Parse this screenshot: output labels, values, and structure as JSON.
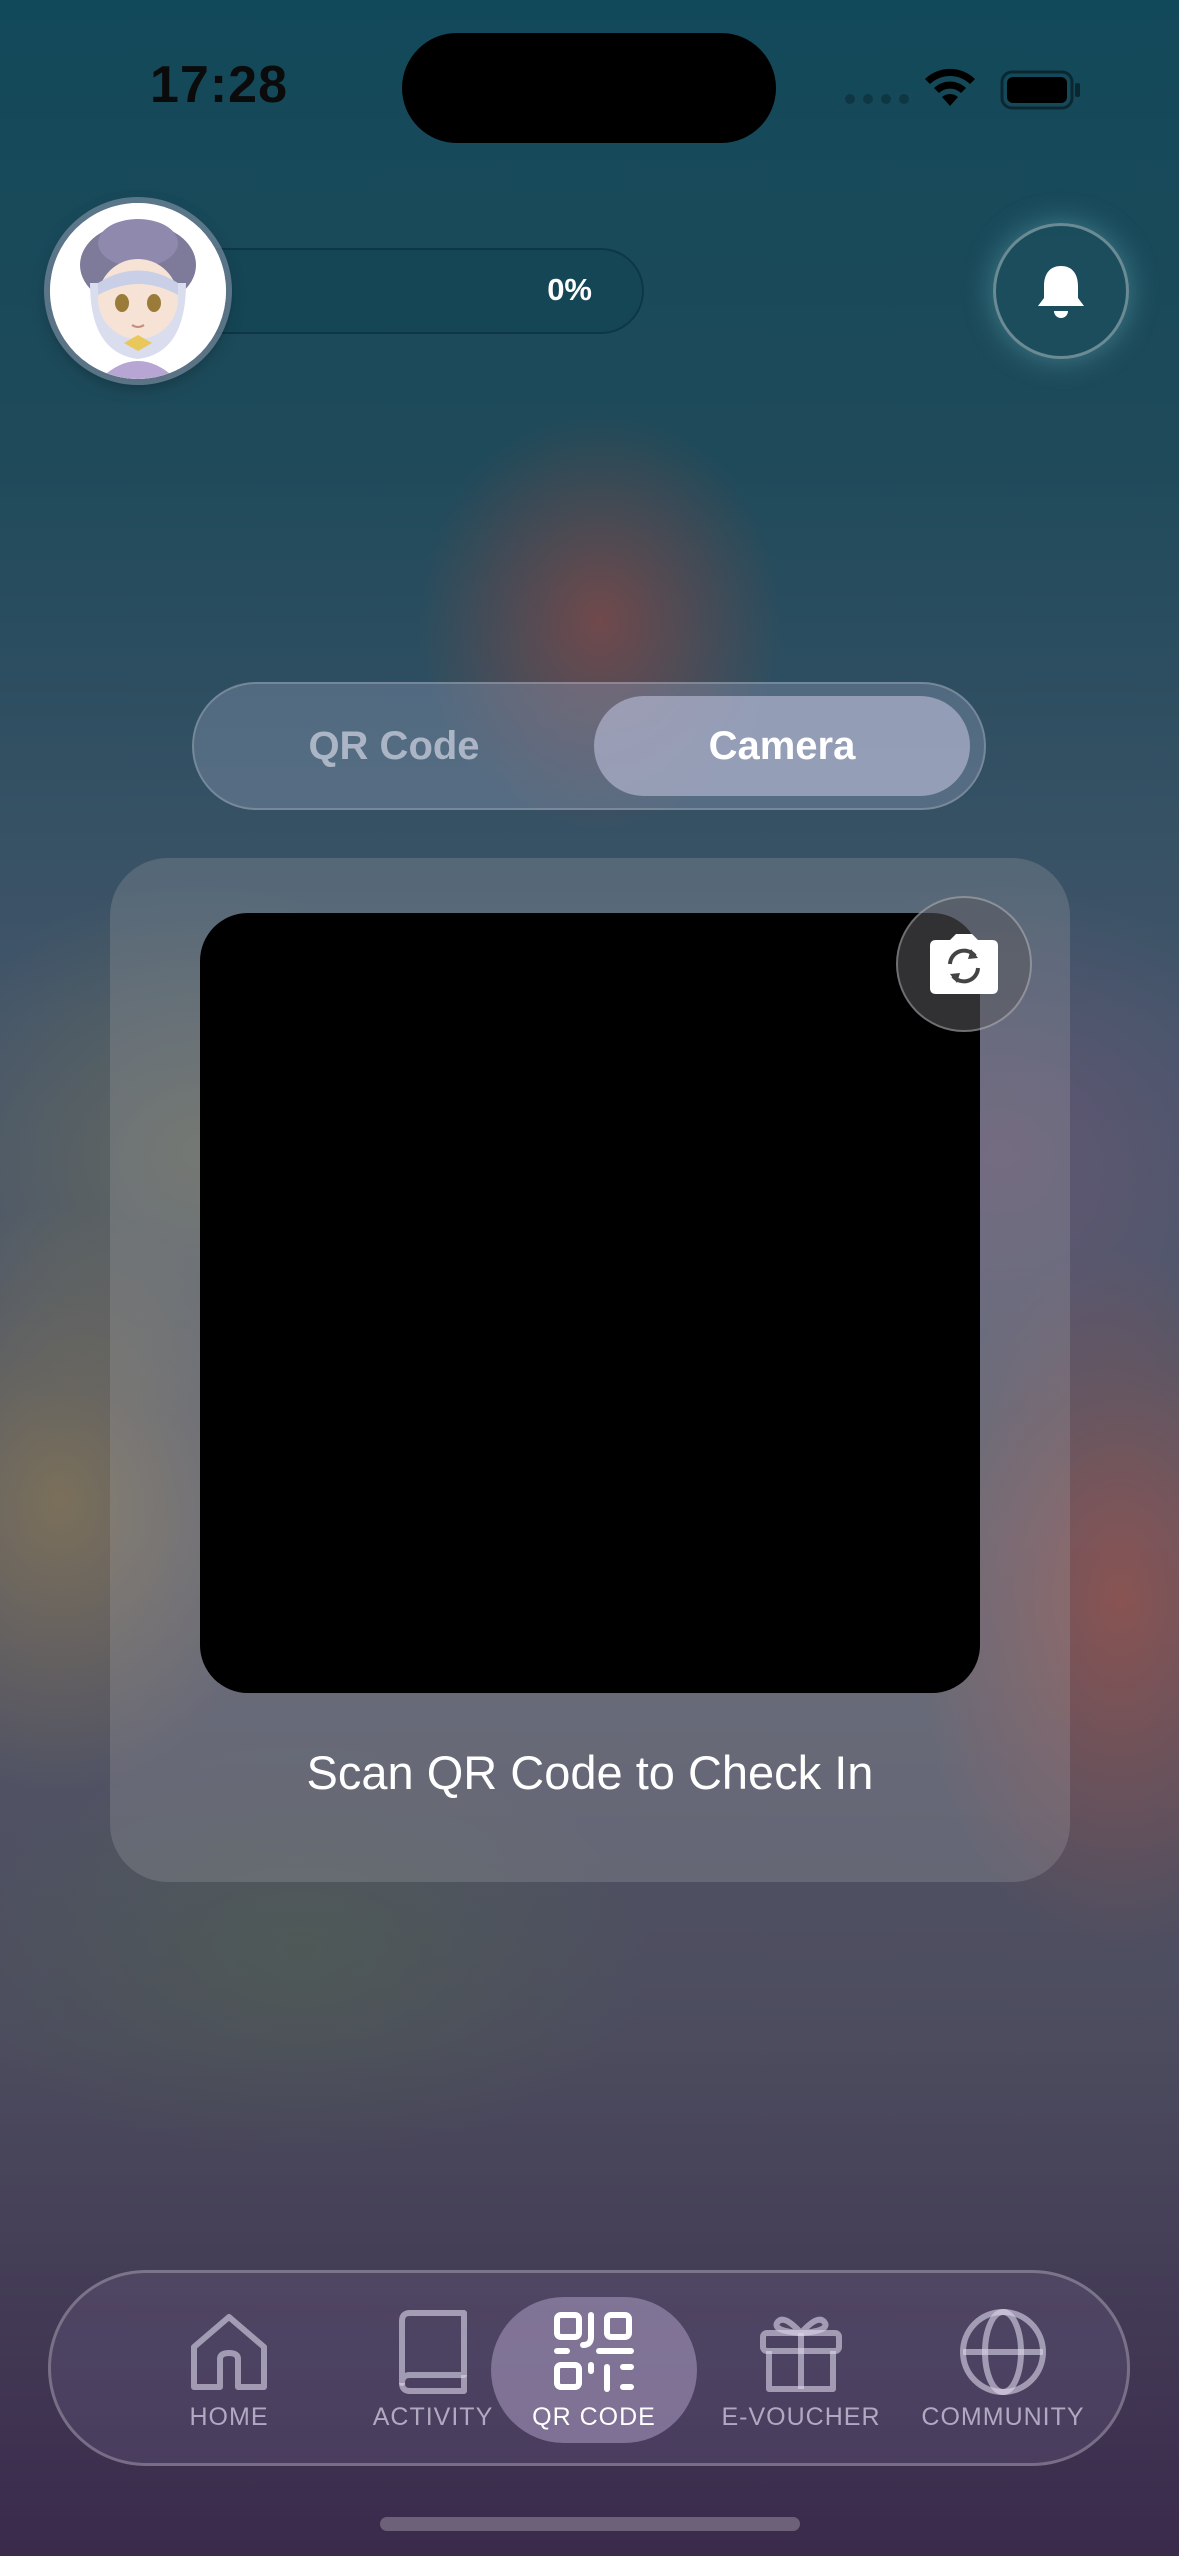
{
  "status_bar": {
    "time": "17:28"
  },
  "header": {
    "progress_text": "0%",
    "progress_value": 0
  },
  "segmented": {
    "qr_label": "QR Code",
    "camera_label": "Camera",
    "selected": "Camera"
  },
  "scanner": {
    "caption": "Scan QR Code to Check In"
  },
  "tabbar": {
    "items": [
      {
        "label": "HOME",
        "icon": "home-icon"
      },
      {
        "label": "ACTIVITY",
        "icon": "book-icon"
      },
      {
        "label": "QR CODE",
        "icon": "qr-code-icon"
      },
      {
        "label": "E-VOUCHER",
        "icon": "gift-icon"
      },
      {
        "label": "COMMUNITY",
        "icon": "globe-icon"
      }
    ],
    "active": "QR CODE"
  },
  "colors": {
    "camera_view": "#000000",
    "accent_active_tab": "#bfaed7"
  }
}
